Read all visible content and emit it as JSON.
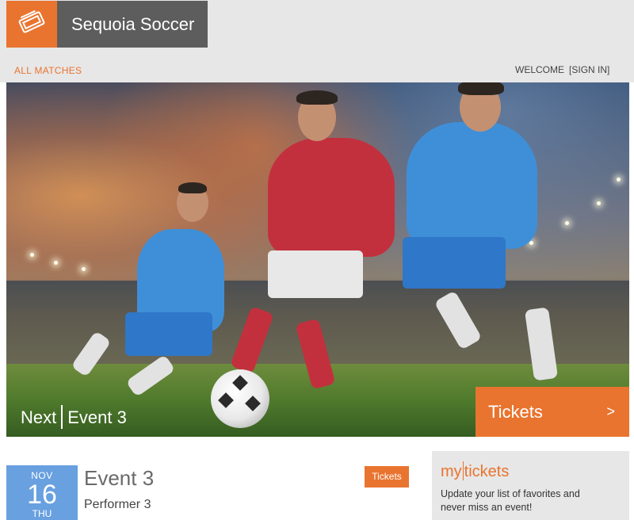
{
  "header": {
    "brand": "Sequoia Soccer",
    "logo_icon": "ticket-icon",
    "nav_all_matches": "ALL MATCHES",
    "welcome": "WELCOME",
    "sign_in": "[SIGN IN]"
  },
  "hero": {
    "next_label": "Next",
    "event_name": "Event 3",
    "tickets_label": "Tickets",
    "tickets_arrow": ">"
  },
  "event": {
    "month": "NOV",
    "day": "16",
    "weekday": "THU",
    "title": "Event 3",
    "performer": "Performer 3",
    "tickets_label": "Tickets"
  },
  "my_tickets": {
    "title_my": "my",
    "title_tickets": "tickets",
    "description": "Update your list of favorites and never miss an event!"
  },
  "colors": {
    "accent": "#e9742f",
    "brand_bg": "#5d5d5d",
    "header_bg": "#e7e7e7",
    "date_bg": "#68a0e0"
  }
}
